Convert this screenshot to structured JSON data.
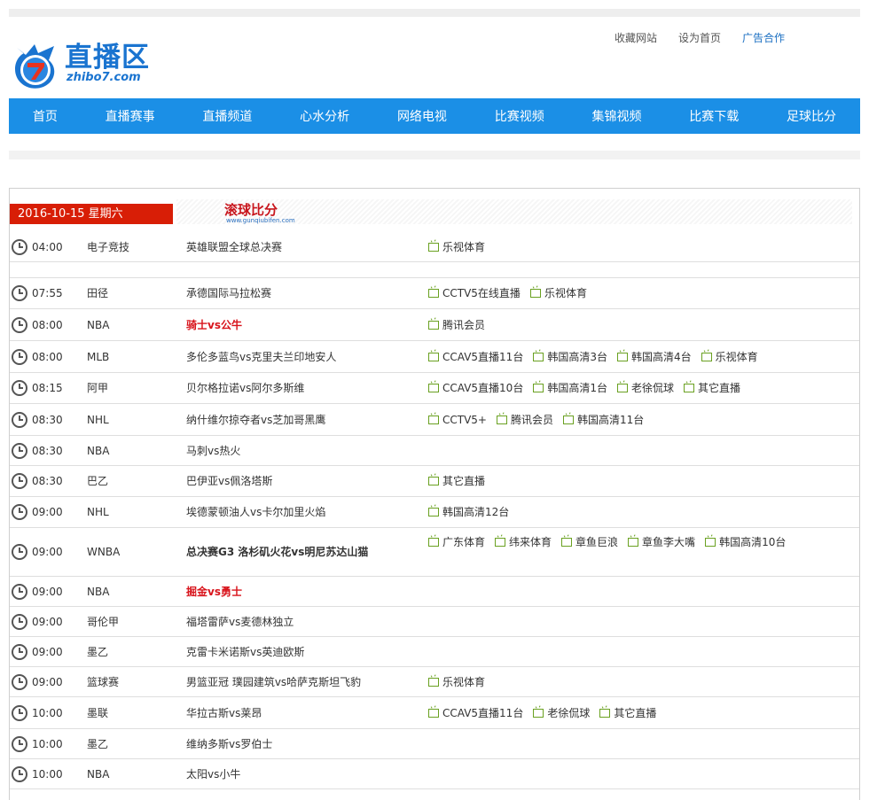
{
  "site": {
    "logo_cn": "直播区",
    "logo_en": "zhibo7.com"
  },
  "toplinks": [
    "收藏网站",
    "设为首页",
    "广告合作"
  ],
  "nav": [
    "首页",
    "直播赛事",
    "直播频道",
    "心水分析",
    "网络电视",
    "比赛视频",
    "集锦视频",
    "比赛下载",
    "足球比分"
  ],
  "date_label": "2016-10-15 星期六",
  "banner": {
    "title": "滚球比分",
    "url": "www.gunqiubifen.com"
  },
  "matches": [
    {
      "time": "04:00",
      "league": "电子竞技",
      "match": "英雄联盟全球总决赛",
      "style": "",
      "channels": [
        "乐视体育"
      ]
    },
    {
      "time": "07:55",
      "league": "田径",
      "match": "承德国际马拉松赛",
      "style": "",
      "channels": [
        "CCTV5在线直播",
        "乐视体育"
      ]
    },
    {
      "time": "08:00",
      "league": "NBA",
      "match": "骑士vs公牛",
      "style": "red",
      "channels": [
        "腾讯会员"
      ]
    },
    {
      "time": "08:00",
      "league": "MLB",
      "match": "多伦多蓝鸟vs克里夫兰印地安人",
      "style": "",
      "channels": [
        "CCAV5直播11台",
        "韩国高清3台",
        "韩国高清4台",
        "乐视体育"
      ]
    },
    {
      "time": "08:15",
      "league": "阿甲",
      "match": "贝尔格拉诺vs阿尔多斯维",
      "style": "",
      "channels": [
        "CCAV5直播10台",
        "韩国高清1台",
        "老徐侃球",
        "其它直播"
      ]
    },
    {
      "time": "08:30",
      "league": "NHL",
      "match": "纳什维尔掠夺者vs芝加哥黑鹰",
      "style": "",
      "channels": [
        "CCTV5+",
        "腾讯会员",
        "韩国高清11台"
      ]
    },
    {
      "time": "08:30",
      "league": "NBA",
      "match": "马刺vs热火",
      "style": "",
      "channels": []
    },
    {
      "time": "08:30",
      "league": "巴乙",
      "match": "巴伊亚vs佩洛塔斯",
      "style": "",
      "channels": [
        "其它直播"
      ]
    },
    {
      "time": "09:00",
      "league": "NHL",
      "match": "埃德蒙顿油人vs卡尔加里火焰",
      "style": "",
      "channels": [
        "韩国高清12台"
      ]
    },
    {
      "time": "09:00",
      "league": "WNBA",
      "match": "总决赛G3 洛杉矶火花vs明尼苏达山猫",
      "style": "bold",
      "channels": [
        "广东体育",
        "纬来体育",
        "章鱼巨浪",
        "章鱼李大嘴",
        "韩国高清10台"
      ]
    },
    {
      "time": "09:00",
      "league": "NBA",
      "match": "掘金vs勇士",
      "style": "red",
      "channels": []
    },
    {
      "time": "09:00",
      "league": "哥伦甲",
      "match": "福塔雷萨vs麦德林独立",
      "style": "",
      "channels": []
    },
    {
      "time": "09:00",
      "league": "墨乙",
      "match": "克雷卡米诺斯vs英迪欧斯",
      "style": "",
      "channels": []
    },
    {
      "time": "09:00",
      "league": "篮球赛",
      "match": "男篮亚冠 璞园建筑vs哈萨克斯坦飞豹",
      "style": "",
      "channels": [
        "乐视体育"
      ]
    },
    {
      "time": "10:00",
      "league": "墨联",
      "match": "华拉古斯vs莱昂",
      "style": "",
      "channels": [
        "CCAV5直播11台",
        "老徐侃球",
        "其它直播"
      ]
    },
    {
      "time": "10:00",
      "league": "墨乙",
      "match": "维纳多斯vs罗伯士",
      "style": "",
      "channels": []
    },
    {
      "time": "10:00",
      "league": "NBA",
      "match": "太阳vs小牛",
      "style": "",
      "channels": []
    }
  ]
}
